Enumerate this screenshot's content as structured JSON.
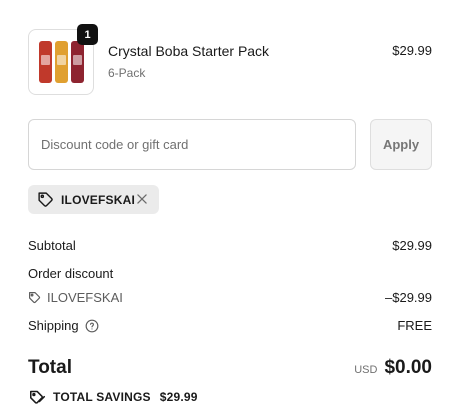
{
  "product": {
    "title": "Crystal Boba Starter Pack",
    "variant": "6-Pack",
    "price": "$29.99",
    "quantity": "1",
    "thumbnail_colors": [
      "#c0392b",
      "#e0a030",
      "#8e2430"
    ]
  },
  "discount": {
    "placeholder": "Discount code or gift card",
    "apply_label": "Apply",
    "applied_code": "ILOVEFSKAI"
  },
  "summary": {
    "subtotal_label": "Subtotal",
    "subtotal_value": "$29.99",
    "order_discount_label": "Order discount",
    "discount_code": "ILOVEFSKAI",
    "discount_value": "–$29.99",
    "shipping_label": "Shipping",
    "shipping_value": "FREE",
    "total_label": "Total",
    "currency": "USD",
    "total_value": "$0.00",
    "savings_label": "TOTAL SAVINGS",
    "savings_value": "$29.99"
  },
  "icons": {
    "tag": "tag-icon",
    "close": "close-icon",
    "help": "question-circle-icon",
    "savings": "tags-icon"
  }
}
